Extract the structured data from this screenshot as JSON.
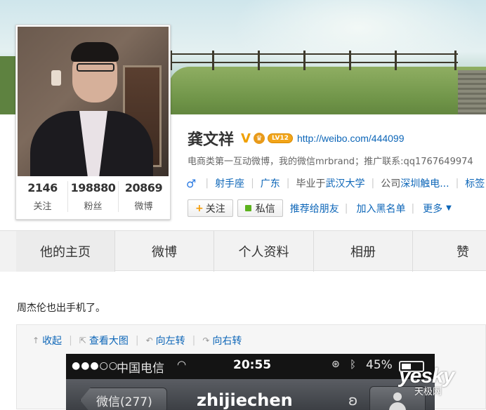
{
  "profile": {
    "name": "龚文祥",
    "verified_badge": "V",
    "level_badge": "LV12",
    "url": "http://weibo.com/444099",
    "description": "电商类第一互动微博，我的微信mrbrand；推广联系:qq1767649974",
    "stats": [
      {
        "value": "2146",
        "label": "关注"
      },
      {
        "value": "198880",
        "label": "粉丝"
      },
      {
        "value": "20869",
        "label": "微博"
      }
    ],
    "meta": {
      "zodiac": "射手座",
      "location": "广东",
      "school_prefix": "毕业于",
      "school": "武汉大学",
      "company_prefix": "公司",
      "company": "深圳触电...",
      "tags": "标签"
    },
    "actions": {
      "follow": "关注",
      "message": "私信",
      "recommend": "推荐给朋友",
      "blacklist": "加入黑名单",
      "more": "更多"
    }
  },
  "tabs": [
    "他的主页",
    "微博",
    "个人资料",
    "相册",
    "赞"
  ],
  "post": {
    "text": "周杰伦也出手机了。",
    "tools": {
      "collapse": "收起",
      "view_large": "查看大图",
      "rotate_left": "向左转",
      "rotate_right": "向右转"
    },
    "screenshot": {
      "signal": "●●●○○",
      "carrier": "中国电信",
      "time": "20:55",
      "battery": "45%",
      "back_label": "微信(277)",
      "chat_title": "zhijiechen"
    }
  },
  "watermark": {
    "main": "yesky",
    "sub": "天极网"
  },
  "colors": {
    "link": "#0d66b8",
    "badge": "#f2a51a",
    "message_icon": "#5cb21d"
  }
}
